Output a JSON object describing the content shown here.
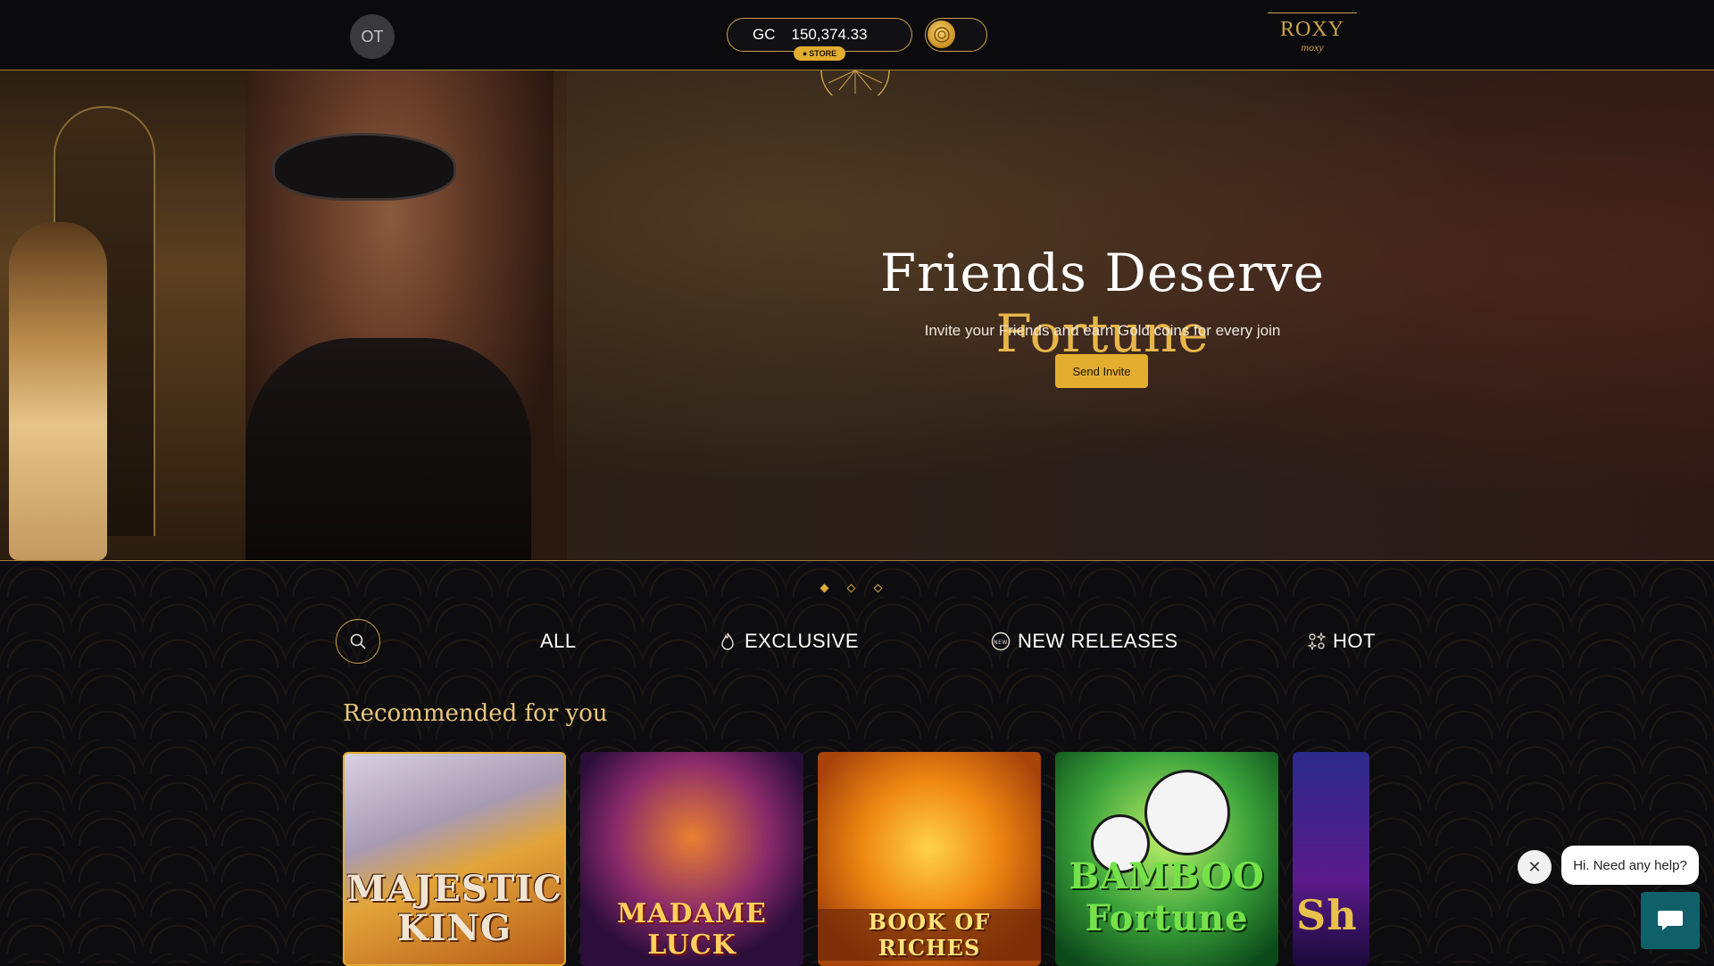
{
  "header": {
    "avatar_initials": "OT",
    "balance": {
      "currency": "GC",
      "amount": "150,374.33",
      "store_label": "STORE"
    },
    "logo": {
      "line1": "ROXY",
      "line2": "moxy"
    }
  },
  "hero": {
    "title_main": "Friends Deserve",
    "title_accent": "Fortune",
    "subtitle": "Invite your Friends and earn Gold coins for every join",
    "cta_label": "Send Invite",
    "slides": 3,
    "active_slide": 1
  },
  "tabs": [
    {
      "label": "ALL",
      "icon": ""
    },
    {
      "label": "EXCLUSIVE",
      "icon": "flame-icon"
    },
    {
      "label": "NEW RELEASES",
      "icon": "new-badge-icon"
    },
    {
      "label": "HOT",
      "icon": "grid-sparkle-icon"
    }
  ],
  "recommended": {
    "title": "Recommended for you",
    "games": [
      {
        "title": "MAJESTIC KING"
      },
      {
        "title": "MADAME LUCK"
      },
      {
        "title": "BOOK OF RICHES"
      },
      {
        "title": "BAMBOO Fortune"
      },
      {
        "title": "Sh"
      }
    ]
  },
  "chat": {
    "greeting": "Hi. Need any help?"
  },
  "colors": {
    "gold": "#e3ad2f",
    "gold_border": "#c9a24a",
    "background": "#0b0a0c",
    "chat_teal": "#0f6068"
  }
}
